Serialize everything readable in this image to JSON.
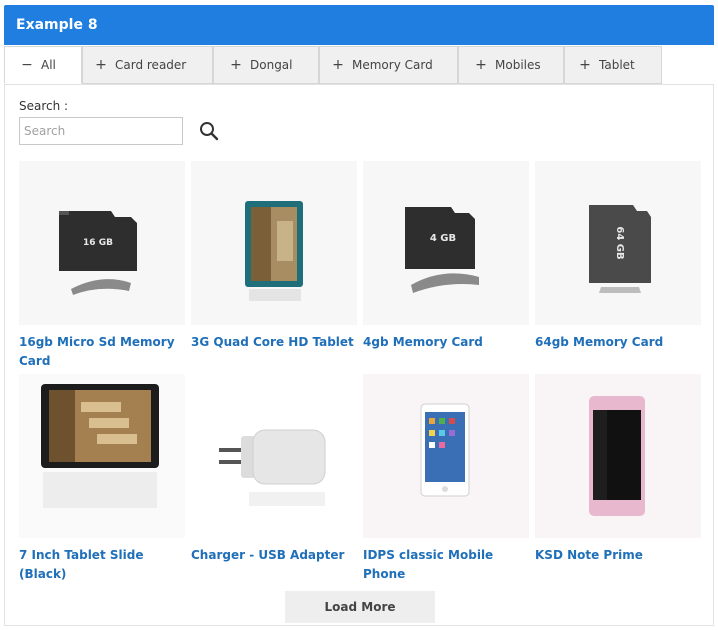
{
  "header": {
    "title": "Example 8"
  },
  "tabs": [
    {
      "sign": "−",
      "label": "All"
    },
    {
      "sign": "+",
      "label": "Card reader"
    },
    {
      "sign": "+",
      "label": "Dongal"
    },
    {
      "sign": "+",
      "label": "Memory Card"
    },
    {
      "sign": "+",
      "label": "Mobiles"
    },
    {
      "sign": "+",
      "label": "Tablet"
    }
  ],
  "search": {
    "label": "Search :",
    "placeholder": "Search",
    "value": ""
  },
  "products": [
    {
      "title": "16gb Micro Sd Memory Card",
      "icon": "microsd-card-icon",
      "card_label": "16 GB"
    },
    {
      "title": "3G Quad Core HD Tablet",
      "icon": "tablet-icon"
    },
    {
      "title": "4gb Memory Card",
      "icon": "microsd-card-icon",
      "card_label": "4 GB"
    },
    {
      "title": "64gb Memory Card",
      "icon": "microsd-card-icon",
      "card_label": "64 GB"
    },
    {
      "title": "7 Inch Tablet Slide (Black)",
      "icon": "tablet-icon"
    },
    {
      "title": "Charger - USB Adapter",
      "icon": "usb-charger-icon"
    },
    {
      "title": "IDPS classic Mobile Phone",
      "icon": "mobile-phone-icon"
    },
    {
      "title": "KSD Note Prime",
      "icon": "mobile-phone-icon"
    }
  ],
  "load_more": "Load More",
  "colors": {
    "header": "#1f7ee0",
    "link": "#1f6fb9",
    "tab_bg": "#f0f0f0"
  }
}
